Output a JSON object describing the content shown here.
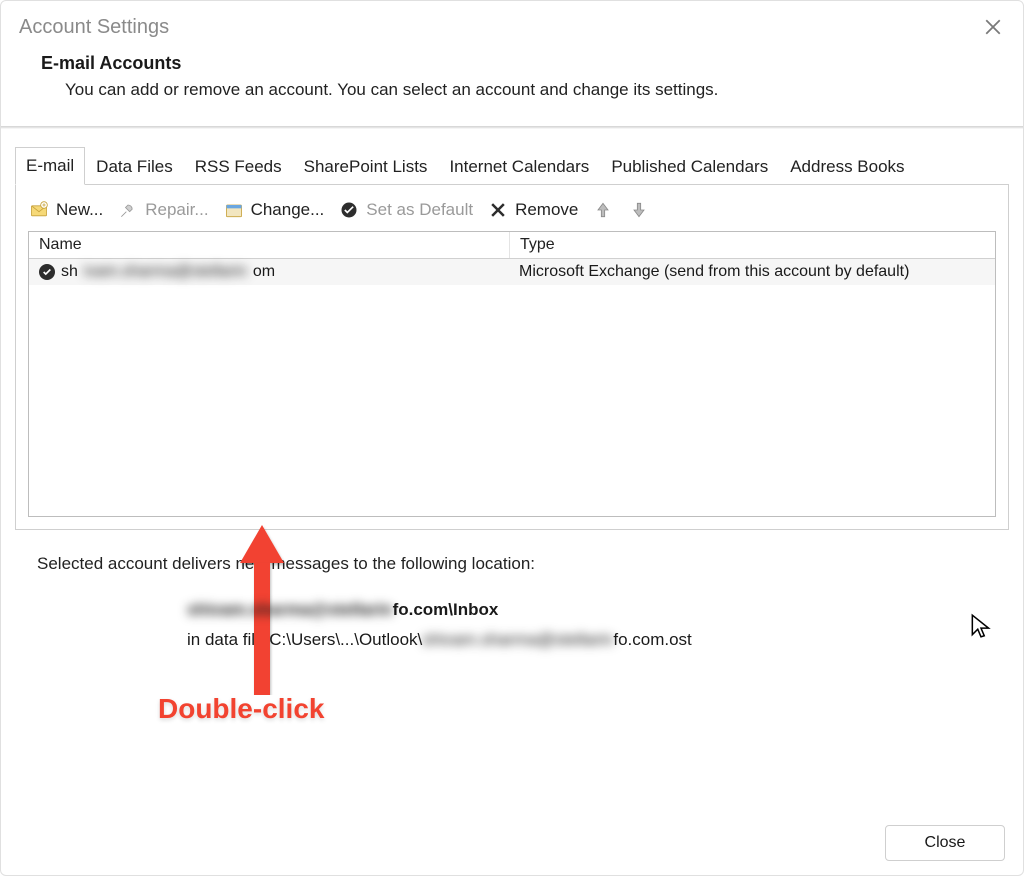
{
  "titlebar": {
    "title": "Account Settings"
  },
  "header": {
    "heading": "E-mail Accounts",
    "subtext": "You can add or remove an account. You can select an account and change its settings."
  },
  "tabs": [
    "E-mail",
    "Data Files",
    "RSS Feeds",
    "SharePoint Lists",
    "Internet Calendars",
    "Published Calendars",
    "Address Books"
  ],
  "toolbar": {
    "new_label": "New...",
    "repair_label": "Repair...",
    "change_label": "Change...",
    "set_default_label": "Set as Default",
    "remove_label": "Remove"
  },
  "list": {
    "columns": {
      "name": "Name",
      "type": "Type"
    },
    "rows": [
      {
        "name_prefix": "sh",
        "name_blur": "ivam.sharma@stellarin",
        "name_suffix": "om",
        "type": "Microsoft Exchange (send from this account by default)"
      }
    ]
  },
  "annotation": {
    "label": "Double-click"
  },
  "footer": {
    "lead": "Selected account delivers new messages to the following location:",
    "line1_blur": "shivam.sharma@stellarin",
    "line1_suffix": "fo.com\\Inbox",
    "line2_prefix": "in data file C:\\Users\\...\\Outlook\\",
    "line2_blur": "shivam.sharma@stellarin",
    "line2_suffix": "fo.com.ost"
  },
  "close_button": "Close"
}
